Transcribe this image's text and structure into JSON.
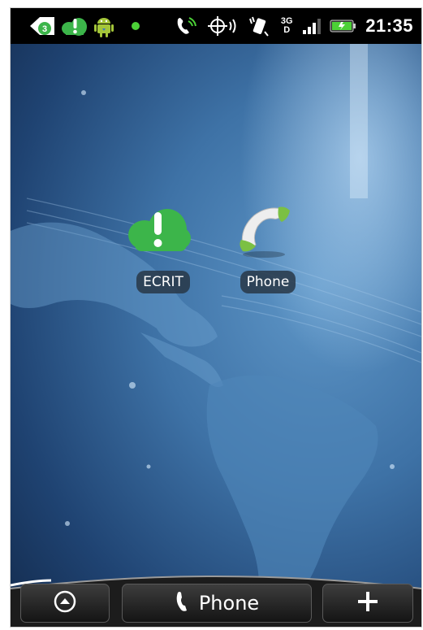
{
  "status_bar": {
    "clock": "21:35",
    "notification_count": "3",
    "network_type_top": "3G",
    "network_type_bottom": "D",
    "icons": [
      "notification-back-icon",
      "ecrit-notification-icon",
      "android-icon",
      "green-dot-icon",
      "phone-call-icon",
      "gps-icon",
      "vibrate-icon",
      "signal-icon",
      "battery-icon"
    ]
  },
  "home": {
    "apps": [
      {
        "label": "ECRIT",
        "icon": "ecrit-cloud-icon"
      },
      {
        "label": "Phone",
        "icon": "phone-handset-icon"
      }
    ]
  },
  "dock": {
    "launcher_icon": "launcher-up-icon",
    "phone_label": "Phone",
    "add_icon": "plus-icon"
  },
  "colors": {
    "status_bar": "#000000",
    "accent_green": "#3cb54a",
    "battery_green": "#4cd137"
  }
}
